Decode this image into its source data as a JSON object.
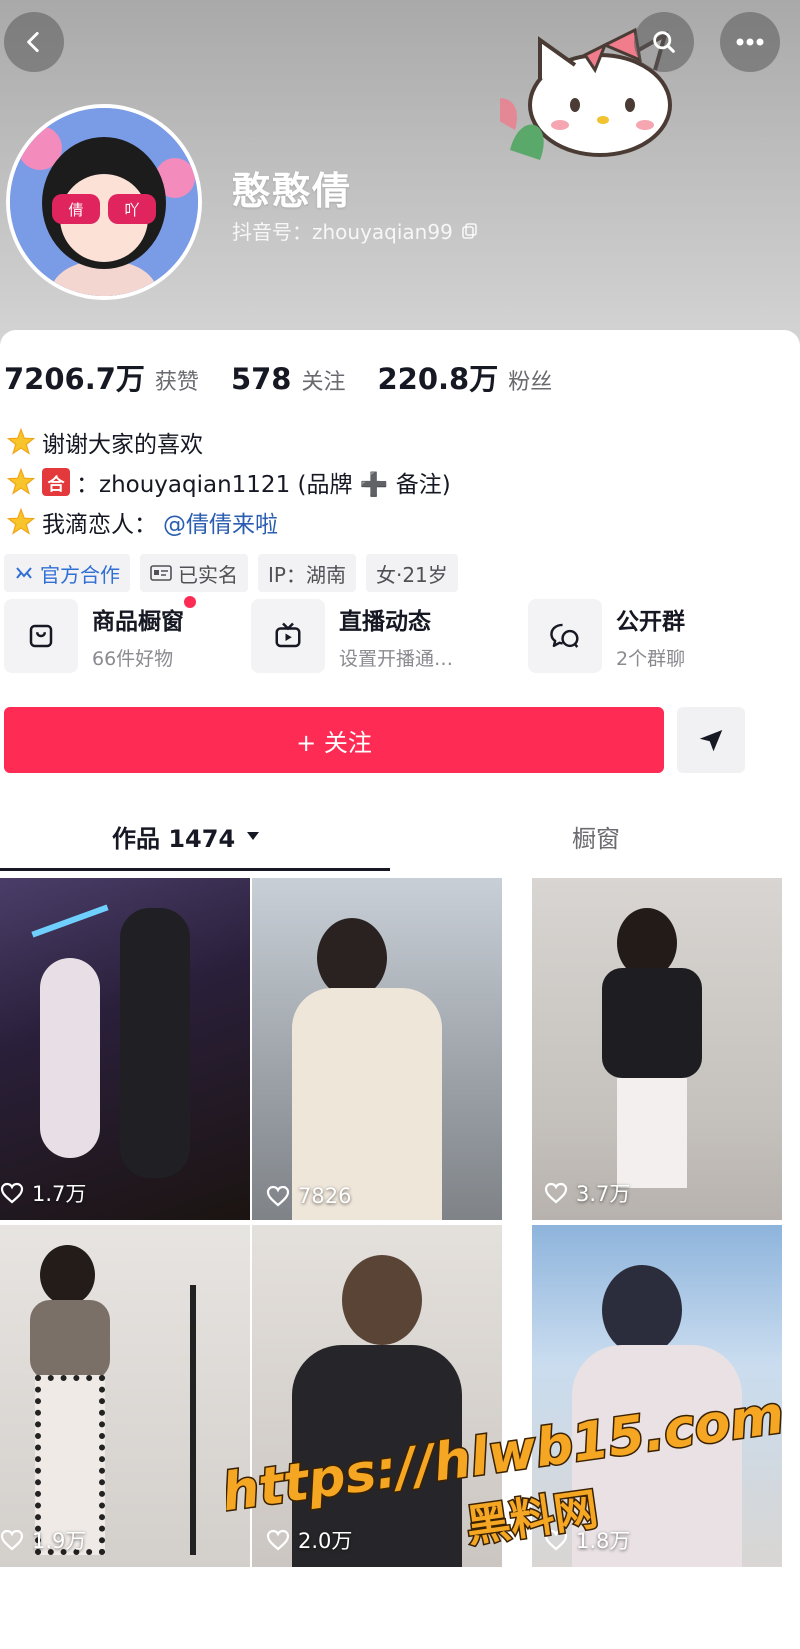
{
  "profile": {
    "nickname": "憨憨倩",
    "douyin_id": "抖音号：zhouyaqian99",
    "avatar_text": "倩 吖"
  },
  "stats": [
    {
      "num": "7206.7万",
      "label": "获赞"
    },
    {
      "num": "578",
      "label": "关注"
    },
    {
      "num": "220.8万",
      "label": "粉丝"
    }
  ],
  "bio": {
    "line1": "谢谢大家的喜欢",
    "line2_badge": "合",
    "line2": "：zhouyaqian1121 (品牌 ➕ 备注)",
    "line3_prefix": "我滴恋人：",
    "line3_mention": "@倩倩来啦"
  },
  "tags": [
    "官方合作",
    "已实名",
    "IP：湖南",
    "女·21岁"
  ],
  "services": [
    {
      "title": "商品橱窗",
      "sub": "66件好物",
      "icon": "bag-icon"
    },
    {
      "title": "直播动态",
      "sub": "设置开播通…",
      "icon": "tv-icon"
    },
    {
      "title": "公开群",
      "sub": "2个群聊",
      "icon": "chat-icon"
    }
  ],
  "actions": {
    "follow_label": "+ 关注"
  },
  "tabs": {
    "works_label": "作品 1474",
    "shop_label": "橱窗"
  },
  "videos": [
    {
      "likes": "1.7万"
    },
    {
      "likes": "7826"
    },
    {
      "likes": "3.7万"
    },
    {
      "likes": "1.9万"
    },
    {
      "likes": "2.0万"
    },
    {
      "likes": "1.8万"
    }
  ],
  "watermark": {
    "line1": "https://hlwb15.com",
    "line2": "黑料网"
  },
  "colors": {
    "accent": "#fe2c55",
    "link": "#2a5db0",
    "official": "#2f6fd6"
  }
}
